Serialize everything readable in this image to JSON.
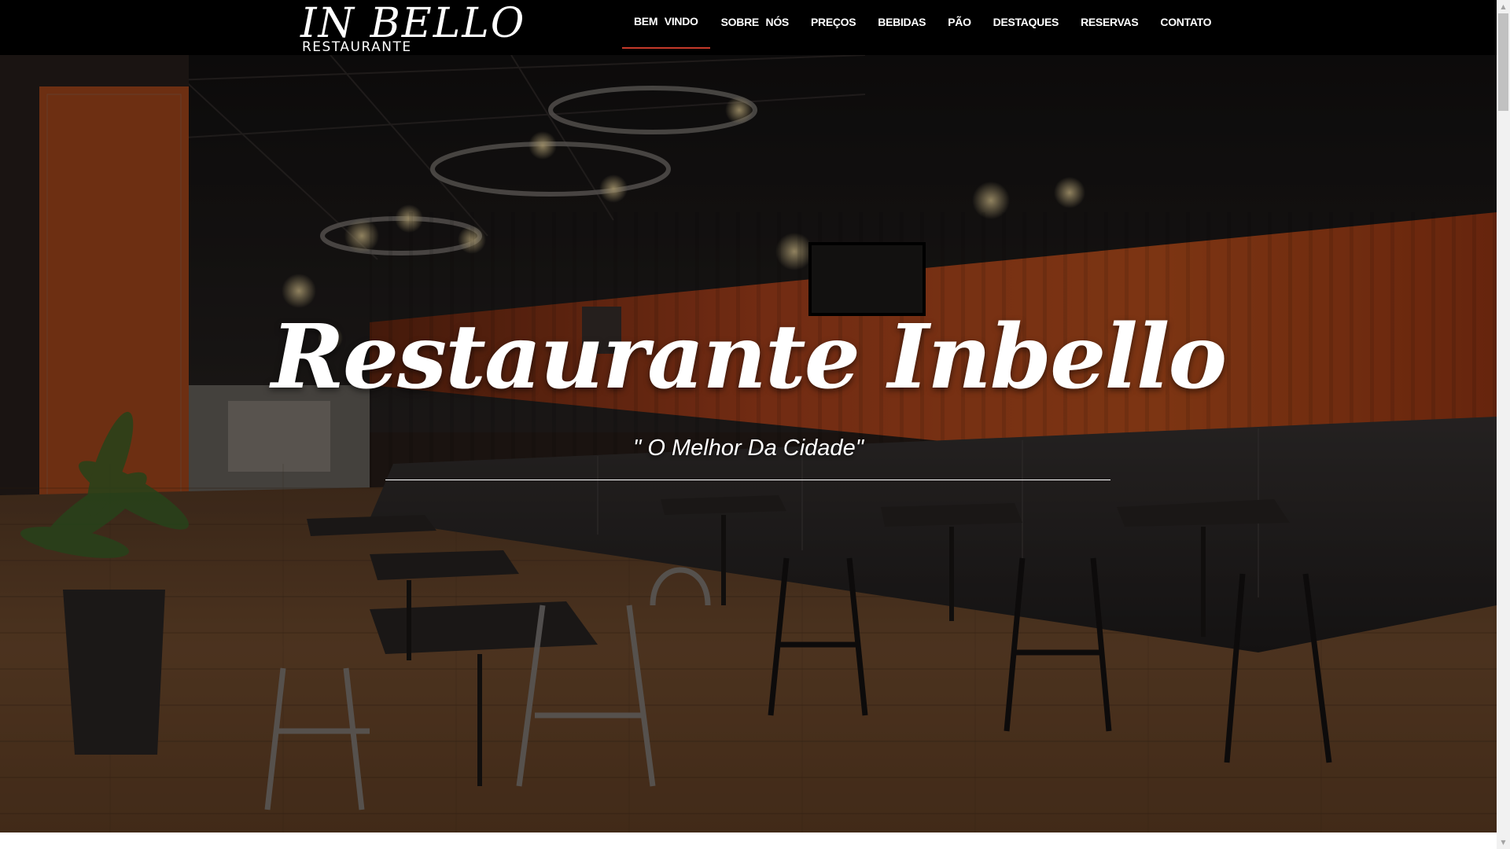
{
  "brand": {
    "name": "IN BELLO",
    "tagline": "RESTAURANTE"
  },
  "nav": {
    "items": [
      {
        "label": "BEM VINDO",
        "active": true
      },
      {
        "label": "SOBRE NÓS",
        "active": false
      },
      {
        "label": "PREÇOS",
        "active": false
      },
      {
        "label": "BEBIDAS",
        "active": false
      },
      {
        "label": "PÃO",
        "active": false
      },
      {
        "label": "DESTAQUES",
        "active": false
      },
      {
        "label": "RESERVAS",
        "active": false
      },
      {
        "label": "CONTATO",
        "active": false
      }
    ],
    "active_underline_color": "#c53a2a"
  },
  "hero": {
    "title": "Restaurante Inbello",
    "subtitle": "\" O Melhor Da Cidade\"",
    "background_description_icon": "restaurant-interior-photo"
  },
  "colors": {
    "navbar_bg": "#000000",
    "text": "#ffffff",
    "wall_orange": "#b8471f",
    "floor_wood": "#7a5232"
  }
}
